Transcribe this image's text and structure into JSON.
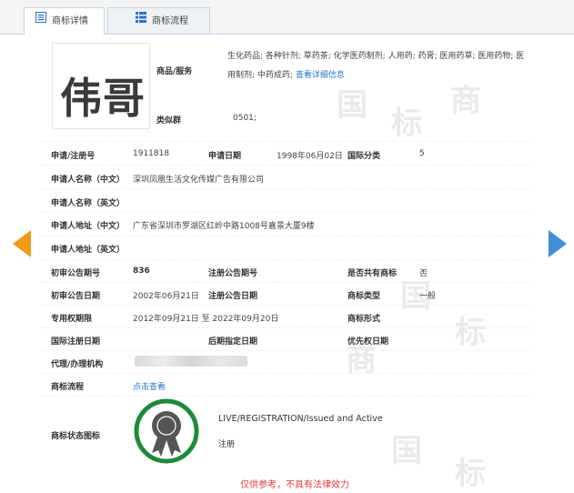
{
  "tabs": [
    {
      "label": "商标详情",
      "icon": "document-list-icon",
      "active": true
    },
    {
      "label": "商标流程",
      "icon": "grid-list-icon",
      "active": false
    }
  ],
  "logo": {
    "text": "伟哥"
  },
  "goods": {
    "label": "商品/服务",
    "value": "生化药品; 各种针剂; 草药茶; 化学医药制剂; 人用药; 药膏; 医用药草; 医用药物; 医用制剂; 中药成药;",
    "link": "查看详细信息"
  },
  "group": {
    "label": "类似群",
    "value": "0501;"
  },
  "fields": {
    "reg_no": {
      "label": "申请/注册号",
      "value": "1911818"
    },
    "app_date": {
      "label": "申请日期",
      "value": "1998年06月02日"
    },
    "intl_class": {
      "label": "国际分类",
      "value": "5"
    },
    "applicant_cn": {
      "label": "申请人名称（中文）",
      "value": "深圳凤凰生活文化传媒广告有限公司"
    },
    "applicant_en": {
      "label": "申请人名称（英文）",
      "value": ""
    },
    "address_cn": {
      "label": "申请人地址（中文）",
      "value": "广东省深圳市罗湖区红岭中路1008号嘉景大厦9楼"
    },
    "address_en": {
      "label": "申请人地址（英文）",
      "value": ""
    },
    "prelim_no": {
      "label": "初审公告期号",
      "value": "836"
    },
    "reg_notice_no": {
      "label": "注册公告期号",
      "value": ""
    },
    "shared": {
      "label": "是否共有商标",
      "value": "否"
    },
    "prelim_date": {
      "label": "初审公告日期",
      "value": "2002年06月21日"
    },
    "reg_notice_date": {
      "label": "注册公告日期",
      "value": ""
    },
    "tm_type": {
      "label": "商标类型",
      "value": "一般"
    },
    "exclusive": {
      "label": "专用权期限",
      "value": "2012年09月21日 至 2022年09月20日"
    },
    "tm_form": {
      "label": "商标形式",
      "value": ""
    },
    "intl_reg_date": {
      "label": "国际注册日期",
      "value": ""
    },
    "later_date": {
      "label": "后期指定日期",
      "value": ""
    },
    "priority_date": {
      "label": "优先权日期",
      "value": ""
    },
    "agent": {
      "label": "代理/办理机构",
      "value": ""
    },
    "flow": {
      "label": "商标流程",
      "link": "点击查看"
    },
    "status_icon": {
      "label": "商标状态图标"
    }
  },
  "status": {
    "en": "LIVE/REGISTRATION/Issued and Active",
    "cn": "注册",
    "icon": "award-ribbon-icon"
  },
  "bottom_notice": "仅供参考，不具有法律效力",
  "colors": {
    "accent": "#2a74c8",
    "prev_arrow": "#f19a1a",
    "next_arrow": "#3f8fd4",
    "badge_ring": "#1e8a3c",
    "notice": "#e23b3b"
  }
}
